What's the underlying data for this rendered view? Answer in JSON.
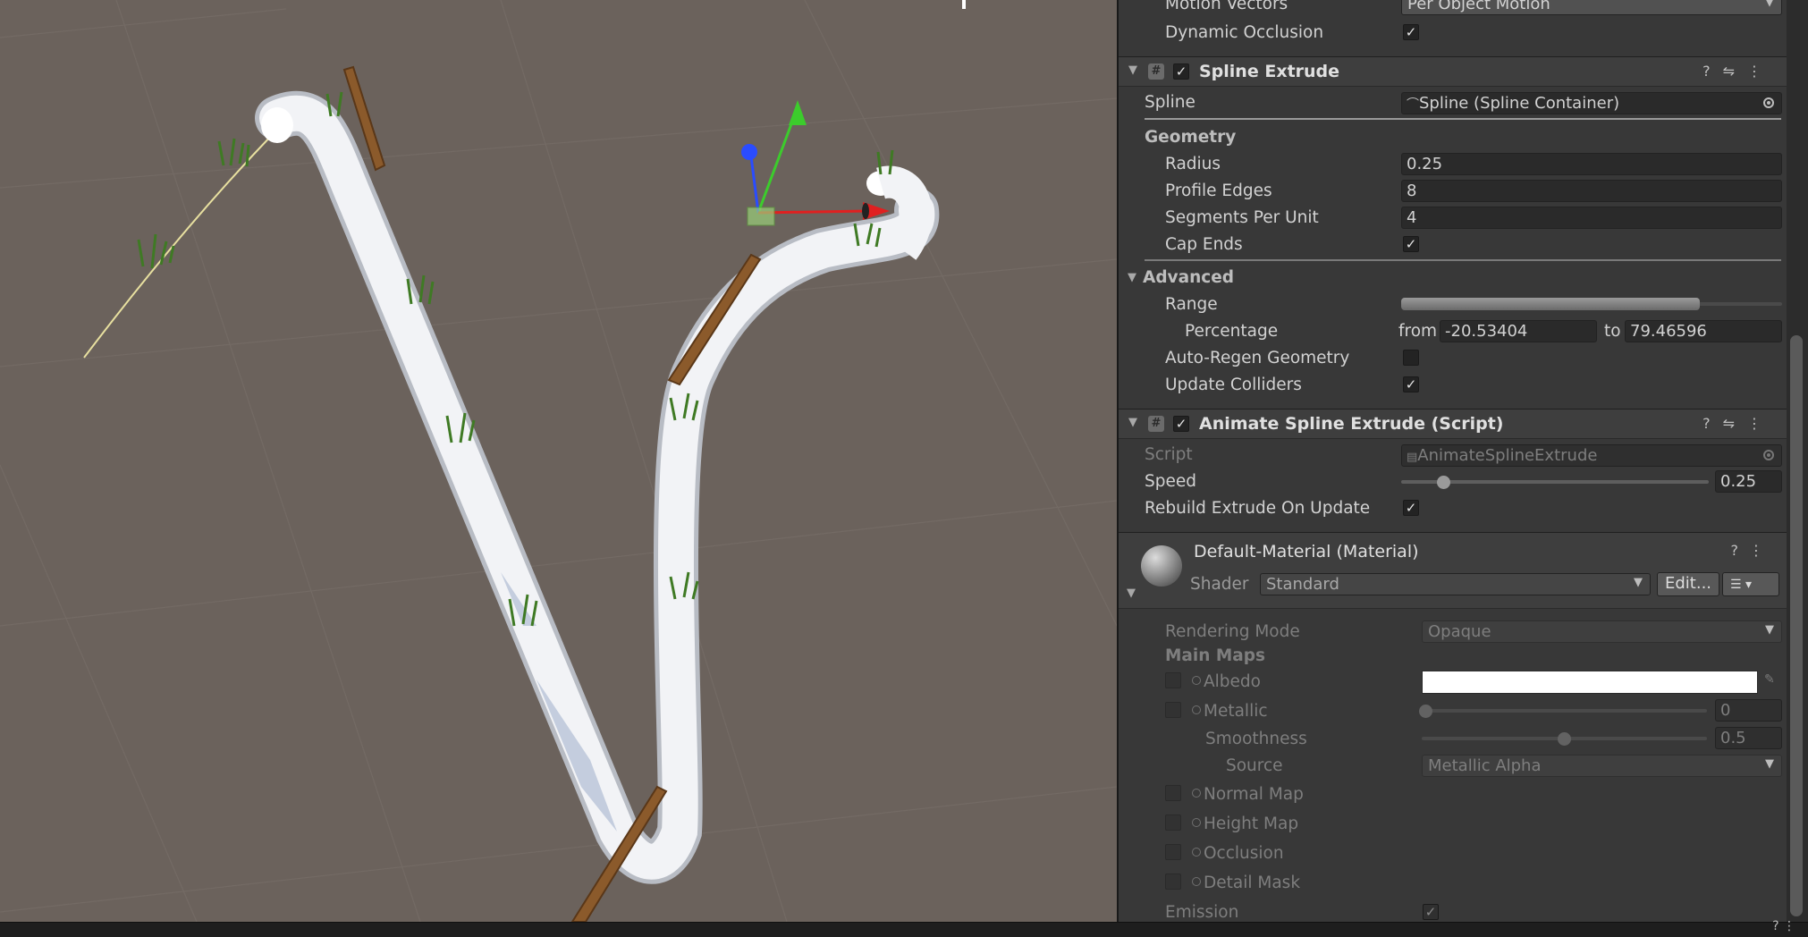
{
  "top": {
    "motion_vectors_label": "Motion Vectors",
    "motion_vectors_value": "Per Object Motion",
    "dynamic_occlusion_label": "Dynamic Occlusion",
    "dynamic_occlusion_checked": true
  },
  "spline_extrude": {
    "title": "Spline Extrude",
    "enabled": true,
    "spline_label": "Spline",
    "spline_value": "Spline (Spline Container)",
    "geometry_header": "Geometry",
    "radius_label": "Radius",
    "radius_value": "0.25",
    "profile_edges_label": "Profile Edges",
    "profile_edges_value": "8",
    "segments_label": "Segments Per Unit",
    "segments_value": "4",
    "cap_ends_label": "Cap Ends",
    "cap_ends_checked": true,
    "advanced_header": "Advanced",
    "range_label": "Range",
    "percentage_label": "Percentage",
    "from_label": "from",
    "from_value": "-20.53404",
    "to_label": "to",
    "to_value": "79.46596",
    "auto_regen_label": "Auto-Regen Geometry",
    "auto_regen_checked": false,
    "update_colliders_label": "Update Colliders",
    "update_colliders_checked": true
  },
  "animate": {
    "title": "Animate Spline Extrude (Script)",
    "enabled": true,
    "script_label": "Script",
    "script_value": "AnimateSplineExtrude",
    "speed_label": "Speed",
    "speed_value": "0.25",
    "rebuild_label": "Rebuild Extrude On Update",
    "rebuild_checked": true
  },
  "material": {
    "title": "Default-Material (Material)",
    "shader_label": "Shader",
    "shader_value": "Standard",
    "edit_button": "Edit...",
    "rendering_mode_label": "Rendering Mode",
    "rendering_mode_value": "Opaque",
    "main_maps_label": "Main Maps",
    "albedo_label": "Albedo",
    "albedo_color": "#ffffff",
    "metallic_label": "Metallic",
    "metallic_value": "0",
    "smoothness_label": "Smoothness",
    "smoothness_value": "0.5",
    "source_label": "Source",
    "source_value": "Metallic Alpha",
    "normal_map_label": "Normal Map",
    "height_map_label": "Height Map",
    "occlusion_label": "Occlusion",
    "detail_mask_label": "Detail Mask",
    "emission_label": "Emission",
    "emission_checked": true
  },
  "colors": {
    "viewport_bg": "#6b625c",
    "inspector_bg": "#383838",
    "gizmo_x": "#e02020",
    "gizmo_y": "#3ccc2c",
    "gizmo_z": "#2a4cff"
  }
}
